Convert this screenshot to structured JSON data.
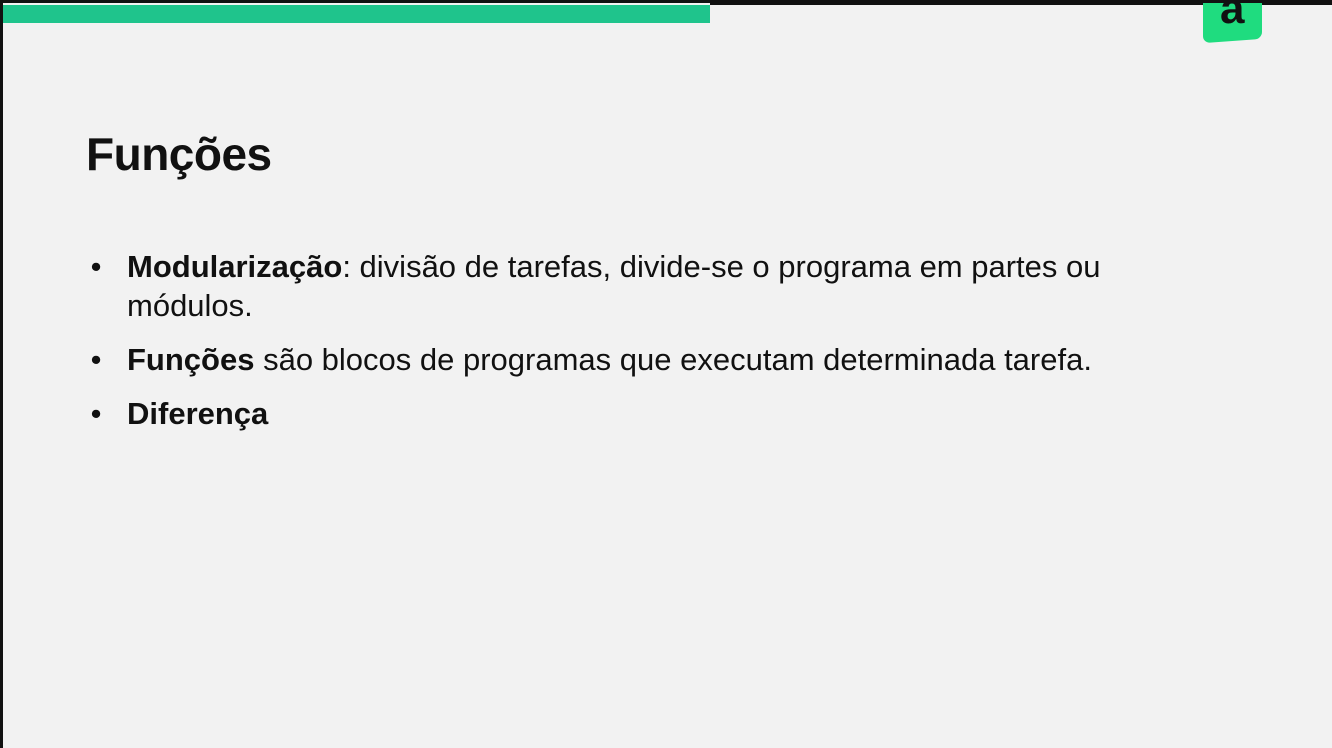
{
  "slide": {
    "logo_glyph": "a",
    "title": "Funções",
    "bullets": [
      {
        "term": "Modularização",
        "text": ": divisão de tarefas, divide-se o programa em partes ou módulos."
      },
      {
        "term": "Funções",
        "text": " são blocos de programas que executam determinada tarefa."
      },
      {
        "term": "Diferença",
        "text": ""
      }
    ]
  },
  "colors": {
    "accent": "#1fc48c",
    "logo": "#1fdc7f",
    "background": "#f2f2f2",
    "text": "#111111"
  },
  "icons": {
    "logo": "brand-logo-a",
    "bullet": "bullet-dot"
  }
}
